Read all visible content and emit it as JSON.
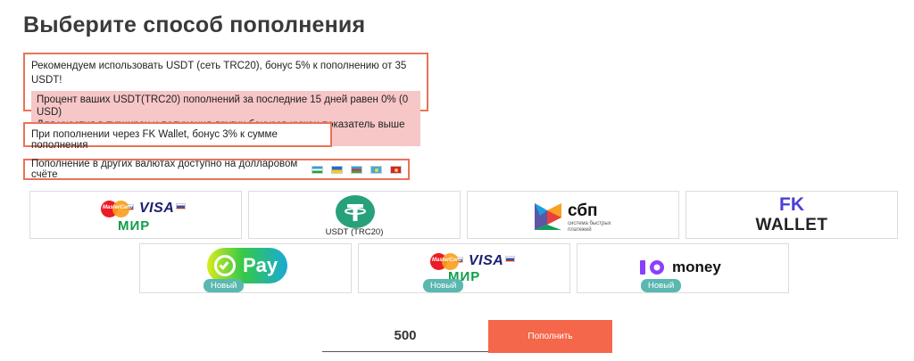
{
  "page": {
    "title": "Выберите способ пополнения"
  },
  "notices": {
    "usdt_recommend": "Рекомендуем использовать USDT (сеть TRC20), бонус 5% к пополнению от 35 USDT!",
    "usdt_warning_line1": "Процент ваших USDT(TRC20) пополнений за последние 15 дней равен 0% (0 USD)",
    "usdt_warning_line2": "Для участия в турнирах и получения других бонусов нужен показатель выше 80%",
    "fk_wallet": "При пополнении через FK Wallet, бонус 3% к сумме пополнения",
    "other_currencies": "Пополнение в других валютах доступно на долларовом счёте"
  },
  "flags": [
    "uz-flag",
    "ua-flag",
    "az-flag",
    "kz-flag",
    "kg-flag"
  ],
  "methods": {
    "cards": {
      "mastercard": "MasterCard",
      "visa": "VISA",
      "mir": "МИР"
    },
    "usdt": {
      "label": "USDT (TRC20)"
    },
    "sbp": {
      "name": "сбп",
      "subtitle_line1": "система быстрых",
      "subtitle_line2": "платежей"
    },
    "fk_wallet": {
      "line1": "FK",
      "line2": "WALLET"
    },
    "sberpay": {
      "label": "Pay",
      "badge": "Новый"
    },
    "cards_new": {
      "mastercard": "MasterCard",
      "visa": "VISA",
      "mir": "МИР",
      "badge": "Новый"
    },
    "yoomoney": {
      "label": "money",
      "badge": "Новый"
    }
  },
  "form": {
    "amount": "500",
    "submit_label": "Пополнить"
  },
  "colors": {
    "accent": "#f5674a",
    "notice_border": "#e8735a",
    "warning_bg": "#f7c6c6",
    "badge": "#5ab8b0"
  }
}
